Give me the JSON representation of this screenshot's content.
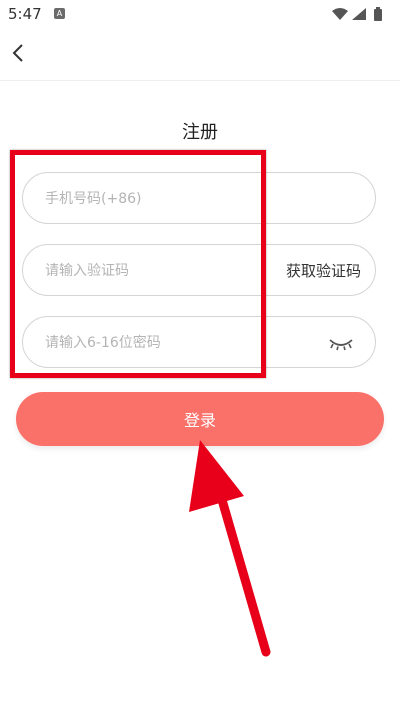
{
  "status_bar": {
    "time": "5:47",
    "notification_icon": "a-icon",
    "icons": [
      "wifi-icon",
      "signal-icon",
      "battery-icon"
    ]
  },
  "header": {
    "back_icon": "chevron-left-icon"
  },
  "page": {
    "title": "注册"
  },
  "form": {
    "phone_placeholder": "手机号码(+86)",
    "code_placeholder": "请输入验证码",
    "get_code_label": "获取验证码",
    "password_placeholder": "请输入6-16位密码",
    "password_toggle_icon": "eye-closed-icon"
  },
  "actions": {
    "login_label": "登录"
  },
  "annotations": {
    "highlight_color": "#e8001b",
    "arrow_color": "#e8001b"
  },
  "colors": {
    "primary_button": "#fa716a",
    "field_border": "#d4d4d4",
    "placeholder": "#b4b4b4"
  }
}
